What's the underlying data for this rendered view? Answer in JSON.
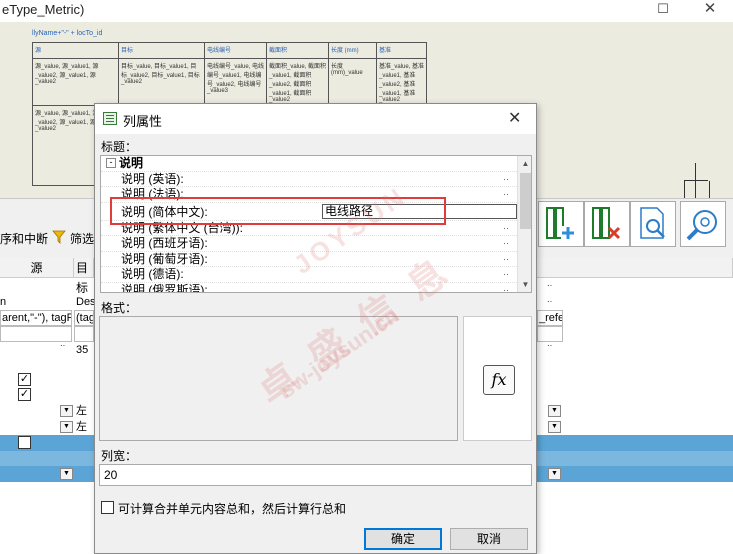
{
  "window": {
    "title": "eType_Metric)",
    "maximize_glyph": "☐",
    "close_glyph": "✕"
  },
  "designer": {
    "formula_hint": "llyName+\"-\" + locTo_id",
    "headers": [
      "源",
      "目标",
      "电线编号",
      "截面积",
      "长度 (mm)",
      "基准"
    ],
    "row1": [
      "源_value, 源_value1, 源_value2, 源_value1, 源_value2",
      "目标_value, 目标_value1, 目标_value2, 目标_value1, 目标_value2",
      "电线编号_value, 电线编号_value1, 电线编号_value2, 电线编号_value3",
      "截面积_value, 截面积_value1, 截面积_value2, 截面积_value1, 截面积_value2",
      "长度(mm)_value",
      "基准_value, 基准_value1, 基准_value2, 基准_value1, 基准_value2"
    ],
    "row2_col1": "源_value, 源_value1, 源_value2, 源_value1, 源_value2"
  },
  "toolbar": {
    "left_label": "序和中断",
    "filter_label": "筛选"
  },
  "grid": {
    "header_source": "源",
    "header_target": "目标",
    "row_n": "n",
    "row_dest": "Dest",
    "row_formula": "arent,\"-\"), tagFro",
    "row_tag": "(tag",
    "row_refer": "_refer",
    "row_35": "35",
    "align_left_1": "左",
    "align_left_2": "左",
    "dots": "··"
  },
  "watermark": {
    "brand_cn": "卓 盛 信 息",
    "brand_url": "sw-joysun.cn",
    "brand_en": "JOYSUN"
  },
  "dialog": {
    "title": "列属性",
    "close_glyph": "✕",
    "caption_label": "标题：",
    "list": {
      "group": "说明",
      "collapse_glyph": "-",
      "items": [
        "说明 (英语):",
        "说明 (法语):",
        "说明 (简体中文):",
        "说明 (繁体中文 (台湾)):",
        "说明 (西班牙语):",
        "说明 (葡萄牙语):",
        "说明 (德语):",
        "说明 (俄罗斯语):"
      ],
      "edit_value": "电线路径",
      "dots": "··"
    },
    "format_label": "格式：",
    "fx_label": "fx",
    "width_label": "列宽：",
    "width_value": "20",
    "checkbox_label": "可计算合并单元内容总和，然后计算行总和",
    "ok_label": "确定",
    "cancel_label": "取消"
  },
  "colors": {
    "highlight": "#e03c3c",
    "selected_band": "#5aa5d6",
    "designer_bg": "#ecebe0"
  }
}
